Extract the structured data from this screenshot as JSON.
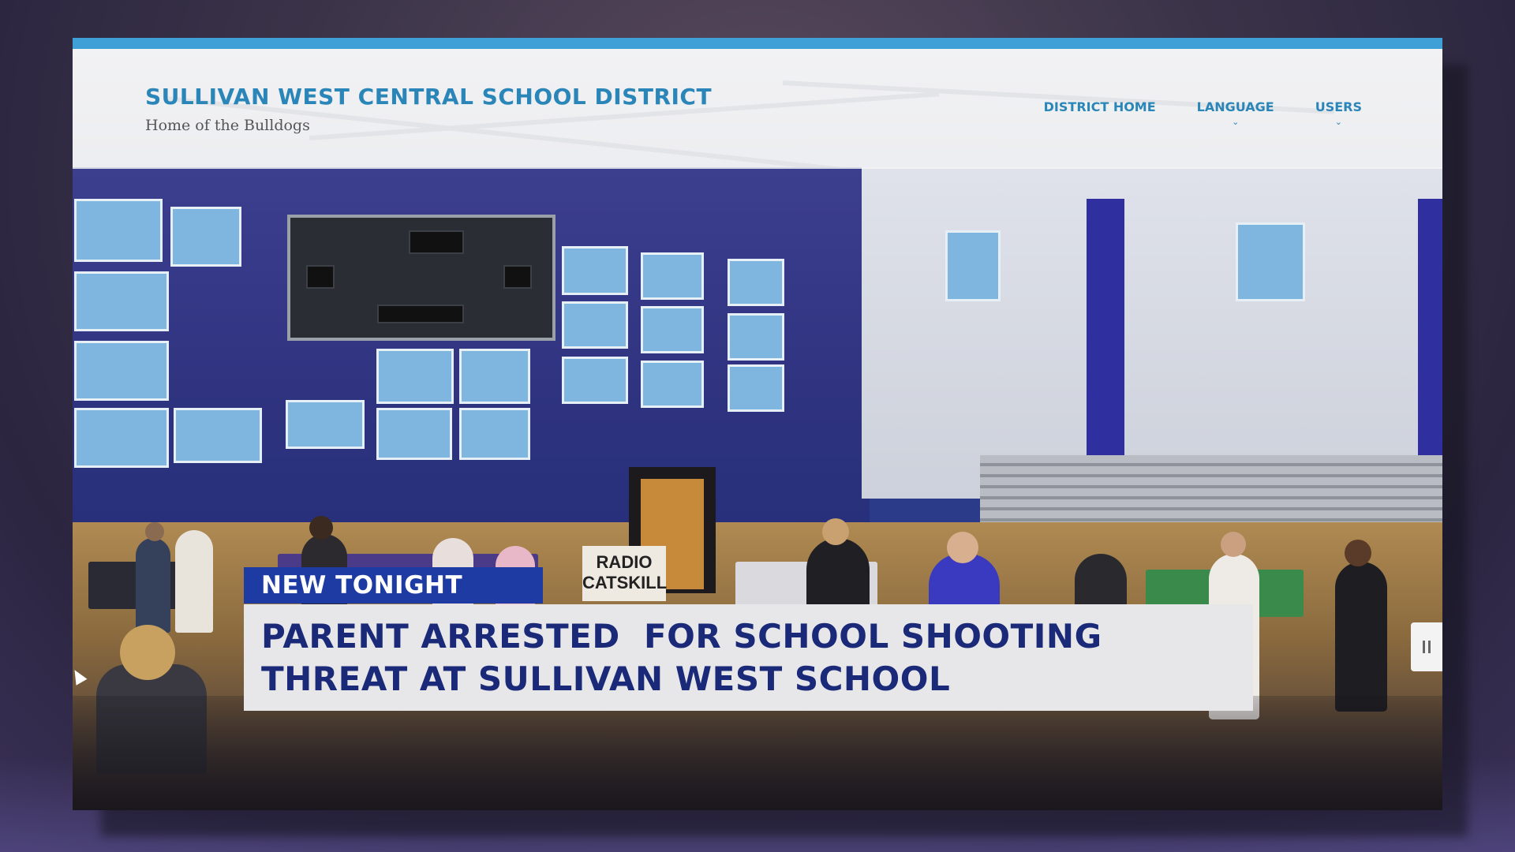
{
  "site": {
    "title": "SULLIVAN WEST CENTRAL SCHOOL DISTRICT",
    "tagline": "Home of the Bulldogs",
    "nav": [
      {
        "label": "DISTRICT HOME",
        "has_dropdown": false
      },
      {
        "label": "LANGUAGE",
        "has_dropdown": true
      },
      {
        "label": "USERS",
        "has_dropdown": true
      }
    ],
    "dropdown_glyph": "⌄"
  },
  "photo": {
    "sign_text": "RADIO\nCATSKILL"
  },
  "lower_third": {
    "kicker": "NEW TONIGHT",
    "headline_line1": "PARENT ARRESTED  FOR SCHOOL SHOOTING",
    "headline_line2": "THREAT AT SULLIVAN WEST SCHOOL"
  },
  "controls": {
    "pause_icon": "pause-icon"
  },
  "colors": {
    "accent_bar": "#3fa0d8",
    "site_link": "#2a86b8",
    "kicker_bg": "#1e3aa3",
    "headline_text": "#1b2a78",
    "headline_bg": "#e7e7ea"
  }
}
